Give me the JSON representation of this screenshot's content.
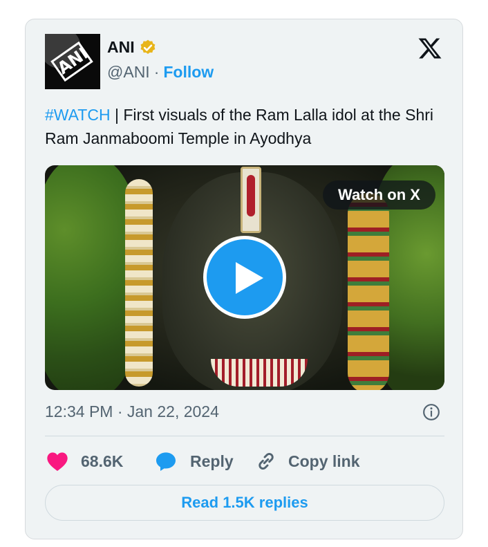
{
  "author": {
    "name": "ANI",
    "handle": "@ANI",
    "separator": "·",
    "follow_label": "Follow",
    "avatar_text": "ANI",
    "verified": true
  },
  "tweet": {
    "hashtag": "#WATCH",
    "text": " | First visuals of the Ram Lalla idol at the Shri Ram Janmaboomi Temple in Ayodhya",
    "timestamp": "12:34 PM · Jan 22, 2024"
  },
  "media": {
    "watch_label": "Watch on X"
  },
  "actions": {
    "likes": "68.6K",
    "reply_label": "Reply",
    "copy_label": "Copy link",
    "read_replies_label": "Read 1.5K replies"
  },
  "colors": {
    "accent": "#1d9bf0",
    "like": "#f91880",
    "verified": "#e8b51a",
    "card_bg": "#eff3f4"
  },
  "icons": [
    "verified-badge-icon",
    "x-logo-icon",
    "play-icon",
    "info-icon",
    "heart-icon",
    "reply-bubble-icon",
    "link-icon"
  ]
}
